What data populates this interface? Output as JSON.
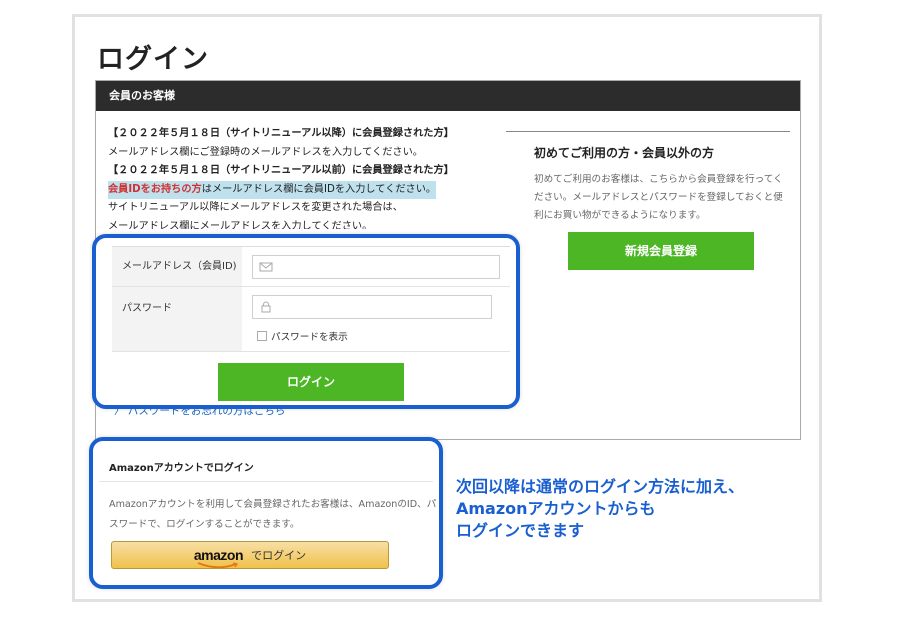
{
  "page_title": "ログイン",
  "members": {
    "header": "会員のお客様",
    "notice": {
      "line1": "【２０２２年５月１８日（サイトリニューアル以降）に会員登録された方】",
      "line2": "メールアドレス欄にご登録時のメールアドレスを入力してください。",
      "line3": "【２０２２年５月１８日（サイトリニューアル以前）に会員登録された方】",
      "line4_red": "会員IDをお持ちの方",
      "line4_rest": "はメールアドレス欄に会員IDを入力してください。",
      "line5": "サイトリニューアル以降にメールアドレスを変更された場合は、",
      "line6": "メールアドレス欄にメールアドレスを入力してください。"
    },
    "form": {
      "email_label": "メールアドレス（会員ID)",
      "password_label": "パスワード",
      "show_password_label": "パスワードを表示",
      "login_button": "ログイン"
    },
    "forgot_link": "パスワードをお忘れの方はこちら"
  },
  "guest": {
    "title": "初めてご利用の方・会員以外の方",
    "description": "初めてご利用のお客様は、こちらから会員登録を行ってください。メールアドレスとパスワードを登録しておくと便利にお買い物ができるようになります。",
    "register_button": "新規会員登録"
  },
  "amazon": {
    "title": "Amazonアカウントでログイン",
    "description": "Amazonアカウントを利用して会員登録されたお客様は、AmazonのID、パスワードで、ログインすることができます。",
    "button_logo": "amazon",
    "button_suffix": "でログイン"
  },
  "callout": {
    "line1": "次回以降は通常のログイン方法に加え、",
    "line2": "Amazonアカウントからも",
    "line3": "ログインできます"
  },
  "colors": {
    "accent_green": "#4cb624",
    "highlight_blue": "#1a5fd0",
    "header_dark": "#2c2c2c",
    "amazon_gold": "#f0c14b"
  }
}
